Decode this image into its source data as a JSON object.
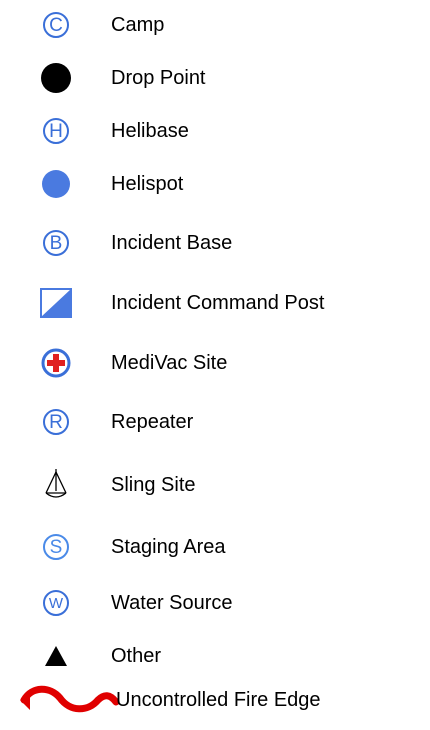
{
  "legend": {
    "items": [
      {
        "label": "Camp",
        "icon": "camp-icon",
        "glyph": "C",
        "color": "#3a6fd8"
      },
      {
        "label": "Drop Point",
        "icon": "drop-point-icon",
        "color": "#000000"
      },
      {
        "label": "Helibase",
        "icon": "helibase-icon",
        "glyph": "H",
        "color": "#3a6fd8"
      },
      {
        "label": "Helispot",
        "icon": "helispot-icon",
        "color": "#4a7ae0"
      },
      {
        "label": "Incident Base",
        "icon": "incident-base-icon",
        "glyph": "B",
        "color": "#3a6fd8"
      },
      {
        "label": "Incident Command Post",
        "icon": "incident-command-post-icon",
        "color": "#4a7ae0"
      },
      {
        "label": "MediVac Site",
        "icon": "medivac-site-icon",
        "color": "#3a6fd8",
        "cross_color": "#e02020"
      },
      {
        "label": "Repeater",
        "icon": "repeater-icon",
        "glyph": "R",
        "color": "#3a6fd8"
      },
      {
        "label": "Sling Site",
        "icon": "sling-site-icon",
        "color": "#000000"
      },
      {
        "label": "Staging Area",
        "icon": "staging-area-icon",
        "glyph": "S",
        "color": "#4a8ae8"
      },
      {
        "label": "Water Source",
        "icon": "water-source-icon",
        "glyph": "W",
        "color": "#3a6fd8"
      },
      {
        "label": "Other",
        "icon": "other-triangle-icon",
        "color": "#000000"
      },
      {
        "label": "Uncontrolled Fire Edge",
        "icon": "uncontrolled-fire-edge-icon",
        "color": "#e00000"
      }
    ]
  }
}
